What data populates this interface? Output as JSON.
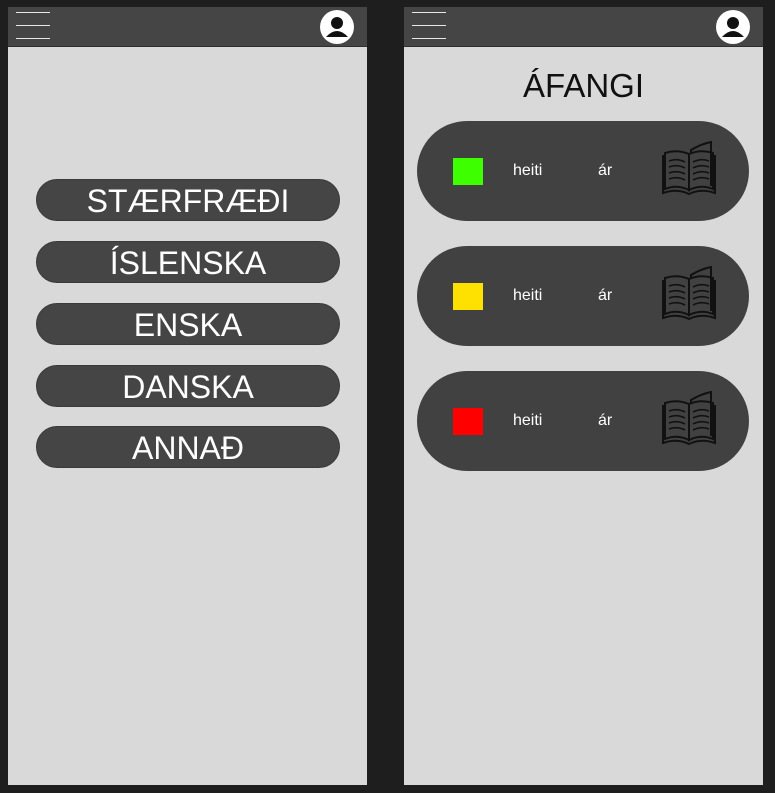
{
  "left_screen": {
    "subjects": [
      {
        "label": "STÆRFRÆÐI"
      },
      {
        "label": "ÍSLENSKA"
      },
      {
        "label": "ENSKA"
      },
      {
        "label": "DANSKA"
      },
      {
        "label": "ANNAÐ"
      }
    ]
  },
  "right_screen": {
    "title": "ÁFANGI",
    "courses": [
      {
        "name": "heiti",
        "year": "ár",
        "color": "#3dff00"
      },
      {
        "name": "heiti",
        "year": "ár",
        "color": "#ffe100"
      },
      {
        "name": "heiti",
        "year": "ár",
        "color": "#ff0000"
      }
    ]
  },
  "icons": {
    "menu": "hamburger-menu-icon",
    "profile": "user-avatar-icon",
    "course": "open-book-icon"
  },
  "colors": {
    "background": "#1e1e1e",
    "screen": "#d9d9d9",
    "bar": "#454545",
    "button": "#454545",
    "card": "#414141"
  }
}
